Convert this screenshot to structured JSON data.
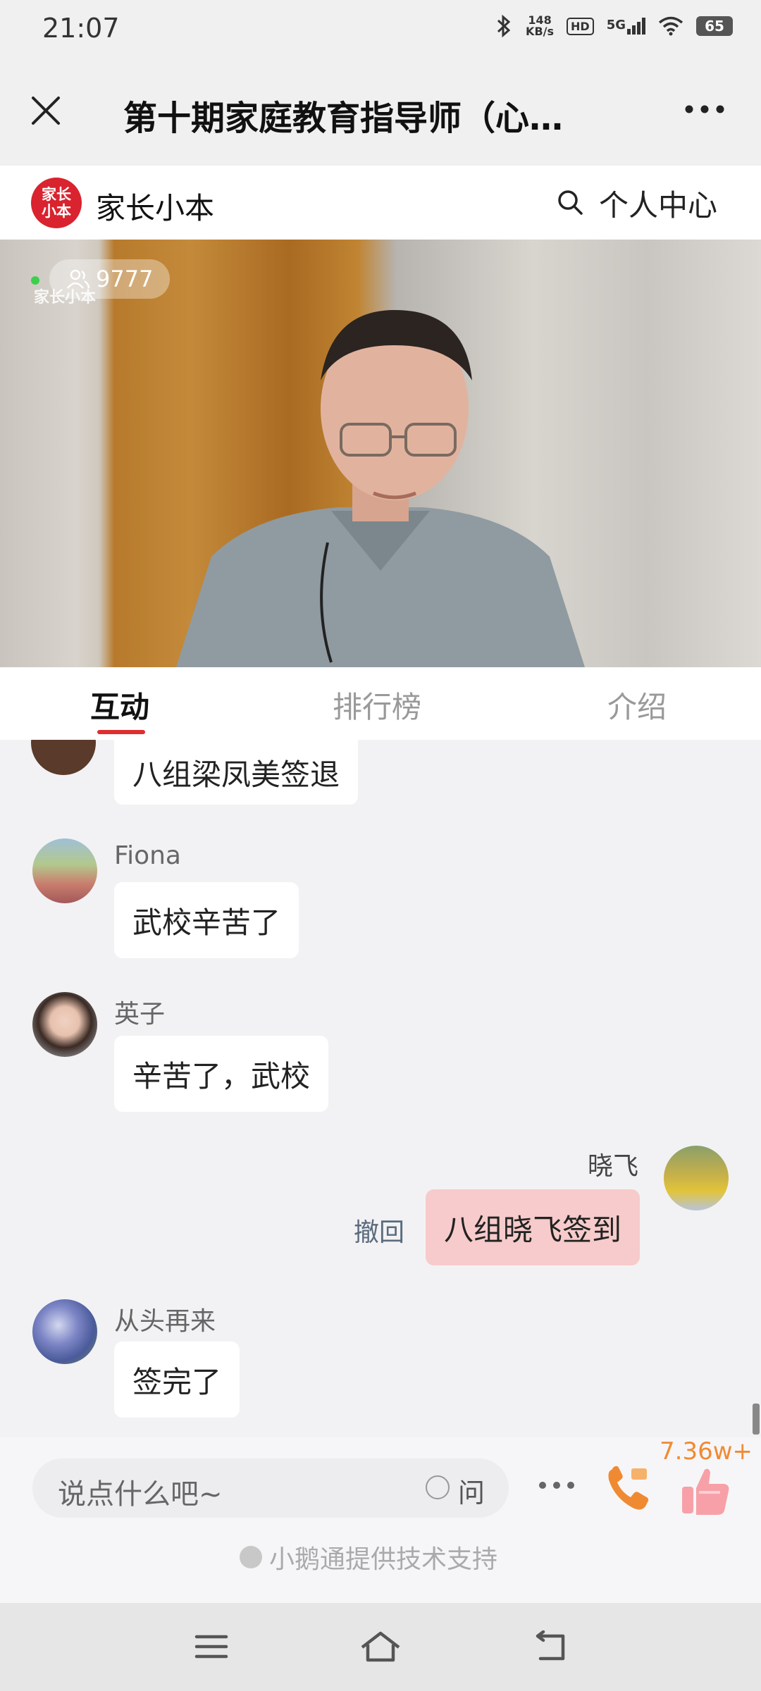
{
  "status": {
    "time": "21:07",
    "net_speed_value": "148",
    "net_speed_unit": "KB/s",
    "hd": "HD",
    "signal": "5G",
    "battery": "65"
  },
  "titlebar": {
    "title": "第十期家庭教育指导师（心…"
  },
  "subheader": {
    "logo_text": "家长小本",
    "brand": "家长小本",
    "personal_center": "个人中心"
  },
  "video": {
    "viewer_count": "9777",
    "watermark": "家长小本"
  },
  "tabs": [
    {
      "label": "互动",
      "active": true
    },
    {
      "label": "排行榜",
      "active": false
    },
    {
      "label": "介绍",
      "active": false
    }
  ],
  "messages": [
    {
      "nick": "",
      "text": "八组梁凤美签退",
      "mine": false
    },
    {
      "nick": "Fiona",
      "text": "武校辛苦了",
      "mine": false
    },
    {
      "nick": "英子",
      "text": "辛苦了，武校",
      "mine": false
    },
    {
      "nick": "晓飞",
      "text": "八组晓飞签到",
      "mine": true,
      "action": "撤回"
    },
    {
      "nick": "从头再来",
      "text": "签完了",
      "mine": false
    }
  ],
  "bottom": {
    "input_placeholder": "说点什么吧~",
    "ask_label": "问",
    "like_count": "7.36w+",
    "powered_by": "小鹅通提供技术支持"
  },
  "colors": {
    "accent": "#e02e2e",
    "like": "#f08a32",
    "my_bubble": "#f7cbcb"
  }
}
